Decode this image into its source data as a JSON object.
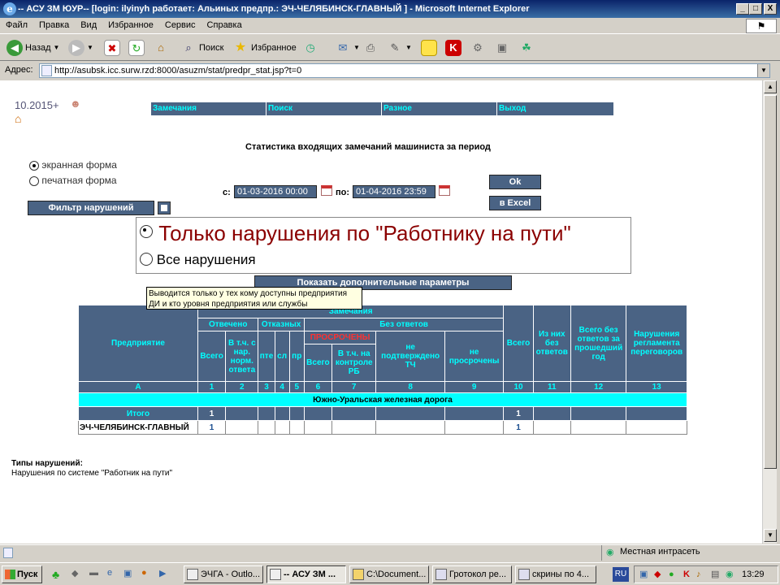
{
  "window": {
    "title": "-- АСУ ЗМ ЮУР-- [login: ilyinyh работает: Альиных предпр.: ЭЧ-ЧЕЛЯБИНСК-ГЛАВНЫЙ ] - Microsoft Internet Explorer",
    "min": "_",
    "max": "□",
    "close": "X"
  },
  "menu": [
    "Файл",
    "Правка",
    "Вид",
    "Избранное",
    "Сервис",
    "Справка"
  ],
  "toolbar": {
    "back": "Назад",
    "search": "Поиск",
    "favorites": "Избранное"
  },
  "address": {
    "label": "Адрес:",
    "url": "http://asubsk.icc.surw.rzd:8000/asuzm/stat/predpr_stat.jsp?t=0"
  },
  "page": {
    "version": "10.2015+",
    "nav": [
      "Замечания",
      "Поиск",
      "Разное",
      "Выход"
    ],
    "heading": "Статистика входящих замечаний машиниста за период",
    "form_screen": "экранная форма",
    "form_print": "печатная форма",
    "from_label": "с:",
    "from_value": "01-03-2016 00:00",
    "to_label": "по:",
    "to_value": "01-04-2016 23:59",
    "ok": "Ok",
    "excel": "в Excel",
    "filter": "Фильтр нарушений",
    "opt_worker": "Только нарушения по \"Работнику на пути\"",
    "opt_all": "Все нарушения",
    "show_params": "Показать дополнительные параметры",
    "tooltip_line1": "Выводится только у тех кому доступны предприятия",
    "tooltip_line2": "ДИ и кто уровня предприятия или службы",
    "types_title": "Типы нарушений:",
    "types_text": "Нарушения по системе \"Работник на пути\""
  },
  "table": {
    "h_enterprise": "Предприятие",
    "h_remarks": "Замечания",
    "h_answered": "Отвечено",
    "h_refusals": "Отказных",
    "h_noanswer": "Без ответов",
    "h_total": "Всего",
    "h_incl_norm": "В т.ч. с нар. норм. ответа",
    "h_pte": "пте",
    "h_sl": "сл",
    "h_pr": "пр",
    "h_overdue": "ПРОСРОЧЕНЫ",
    "h_over_total": "Всего",
    "h_over_ctrl": "В т.ч. на контроле РБ",
    "h_unconfirmed": "не подтверждено ТЧ",
    "h_notoverdue": "не просрочены",
    "h_total10": "Всего",
    "h_of_them": "Из них без ответов",
    "h_lastyear": "Всего без ответов за прошедший год",
    "h_violations": "Нарушения регламента переговоров",
    "nums": [
      "А",
      "1",
      "2",
      "3",
      "4",
      "5",
      "6",
      "7",
      "8",
      "9",
      "10",
      "11",
      "12",
      "13"
    ],
    "railway": "Южно-Уральская железная дорога",
    "total_label": "Итого",
    "total_row": [
      "1",
      "",
      "",
      "",
      "",
      "",
      "",
      "",
      "",
      "1",
      "",
      "",
      ""
    ],
    "ent_label": "ЭЧ-ЧЕЛЯБИНСК-ГЛАВНЫЙ",
    "ent_row": [
      "1",
      "",
      "",
      "",
      "",
      "",
      "",
      "",
      "",
      "1",
      "",
      "",
      ""
    ]
  },
  "status": {
    "zone": "Местная интрасеть"
  },
  "taskbar": {
    "start": "Пуск",
    "tasks": [
      "ЭЧГА - Outlo...",
      "-- АСУ ЗМ ...",
      "C:\\Document...",
      "Гротокол ре...",
      "скрины по 4..."
    ],
    "lang": "RU",
    "clock": "13:29"
  }
}
